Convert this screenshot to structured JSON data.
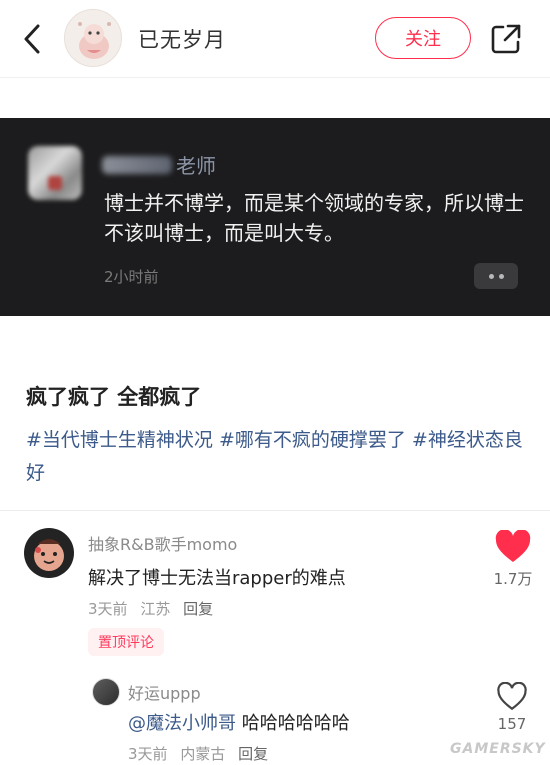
{
  "header": {
    "author_name": "已无岁月",
    "follow_label": "关注"
  },
  "quoted_card": {
    "name_suffix": "老师",
    "text": "博士并不博学，而是某个领域的专家，所以博士不该叫博士，而是叫大专。",
    "time": "2小时前"
  },
  "post": {
    "title": "疯了疯了 全都疯了",
    "tags": "#当代博士生精神状况 #哪有不疯的硬撑罢了 #神经状态良好"
  },
  "comment": {
    "author": "抽象R&B歌手momo",
    "text": "解决了博士无法当rapper的难点",
    "time": "3天前",
    "location": "江苏",
    "reply_label": "回复",
    "pinned_label": "置顶评论",
    "like_count": "1.7万",
    "liked": true,
    "like_color": "#ff2e4d"
  },
  "reply": {
    "author": "好运uppp",
    "mention": "@魔法小帅哥",
    "text": " 哈哈哈哈哈哈",
    "time": "3天前",
    "location": "内蒙古",
    "reply_label": "回复",
    "like_count": "157",
    "liked": false
  },
  "watermark": "GAMERSKY",
  "icons": {
    "back": "chevron-left-icon",
    "share": "share-icon",
    "more": "more-dots-icon",
    "like": "heart-icon"
  }
}
